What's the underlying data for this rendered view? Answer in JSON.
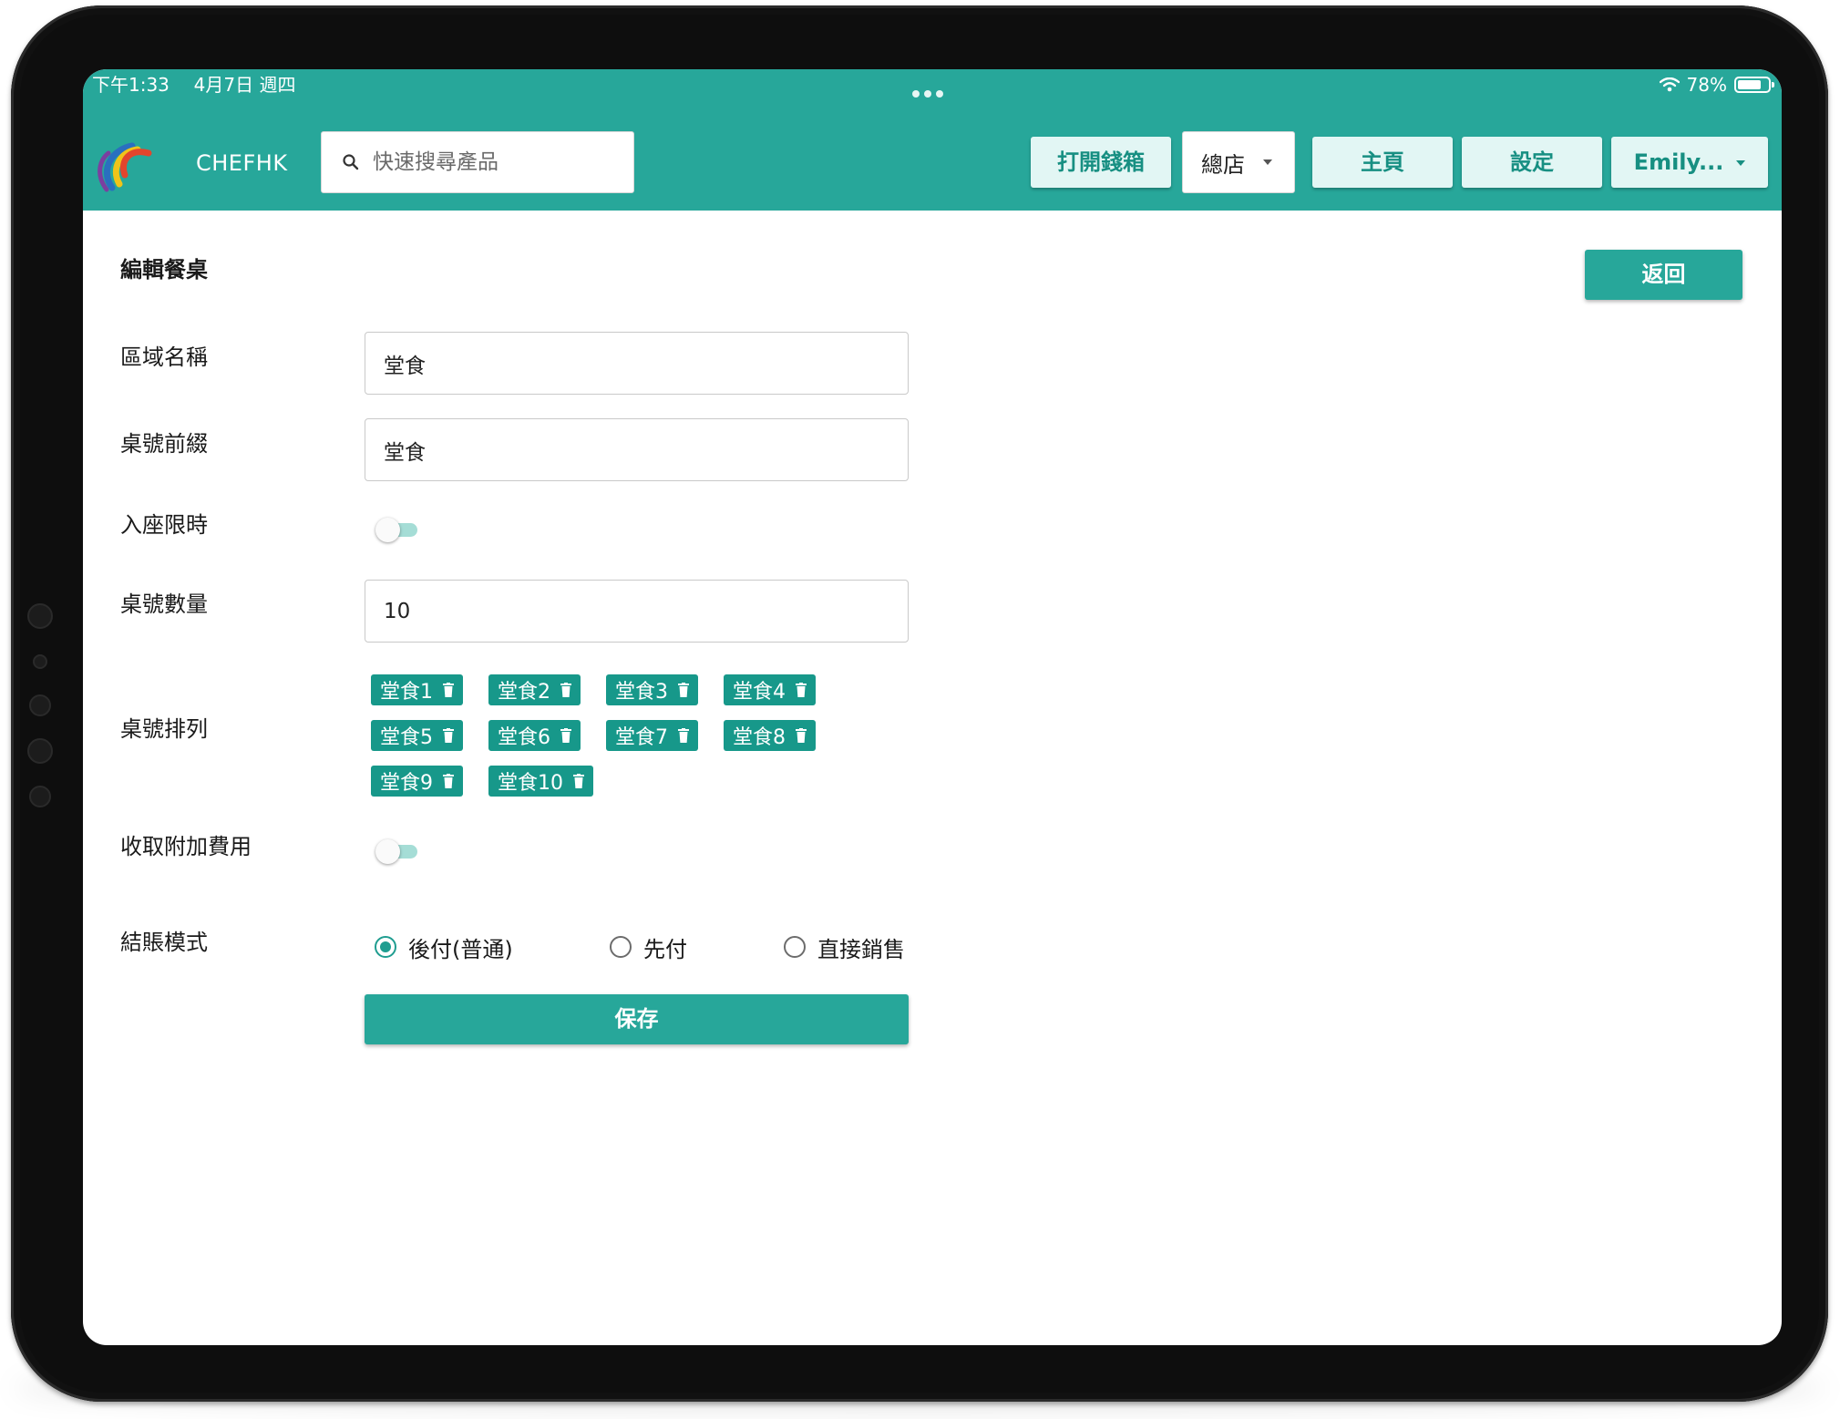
{
  "status_bar": {
    "time": "下午1:33",
    "date": "4月7日 週四",
    "battery": "78%",
    "battery_level": 0.78
  },
  "header": {
    "app_name": "CHEFHK",
    "search_placeholder": "快速搜尋產品",
    "open_cashbox_label": "打開錢箱",
    "store_selected": "總店",
    "home_label": "主頁",
    "settings_label": "設定",
    "user_label": "Emily..."
  },
  "page": {
    "title": "編輯餐桌",
    "back_label": "返回"
  },
  "form": {
    "area_name_label": "區域名稱",
    "area_name_value": "堂食",
    "table_prefix_label": "桌號前綴",
    "table_prefix_value": "堂食",
    "time_limit_label": "入座限時",
    "time_limit_on": false,
    "table_count_label": "桌號數量",
    "table_count_value": "10",
    "table_order_label": "桌號排列",
    "tables": [
      "堂食1",
      "堂食2",
      "堂食3",
      "堂食4",
      "堂食5",
      "堂食6",
      "堂食7",
      "堂食8",
      "堂食9",
      "堂食10"
    ],
    "extra_charge_label": "收取附加費用",
    "extra_charge_on": false,
    "checkout_mode_label": "結賬模式",
    "checkout_options": [
      "後付(普通)",
      "先付",
      "直接銷售"
    ],
    "checkout_selected": "後付(普通)",
    "save_label": "保存"
  },
  "colors": {
    "primary": "#27a79a",
    "chip": "#17988a",
    "header_button_bg": "#e2f6f4",
    "header_button_text": "#178f82"
  }
}
